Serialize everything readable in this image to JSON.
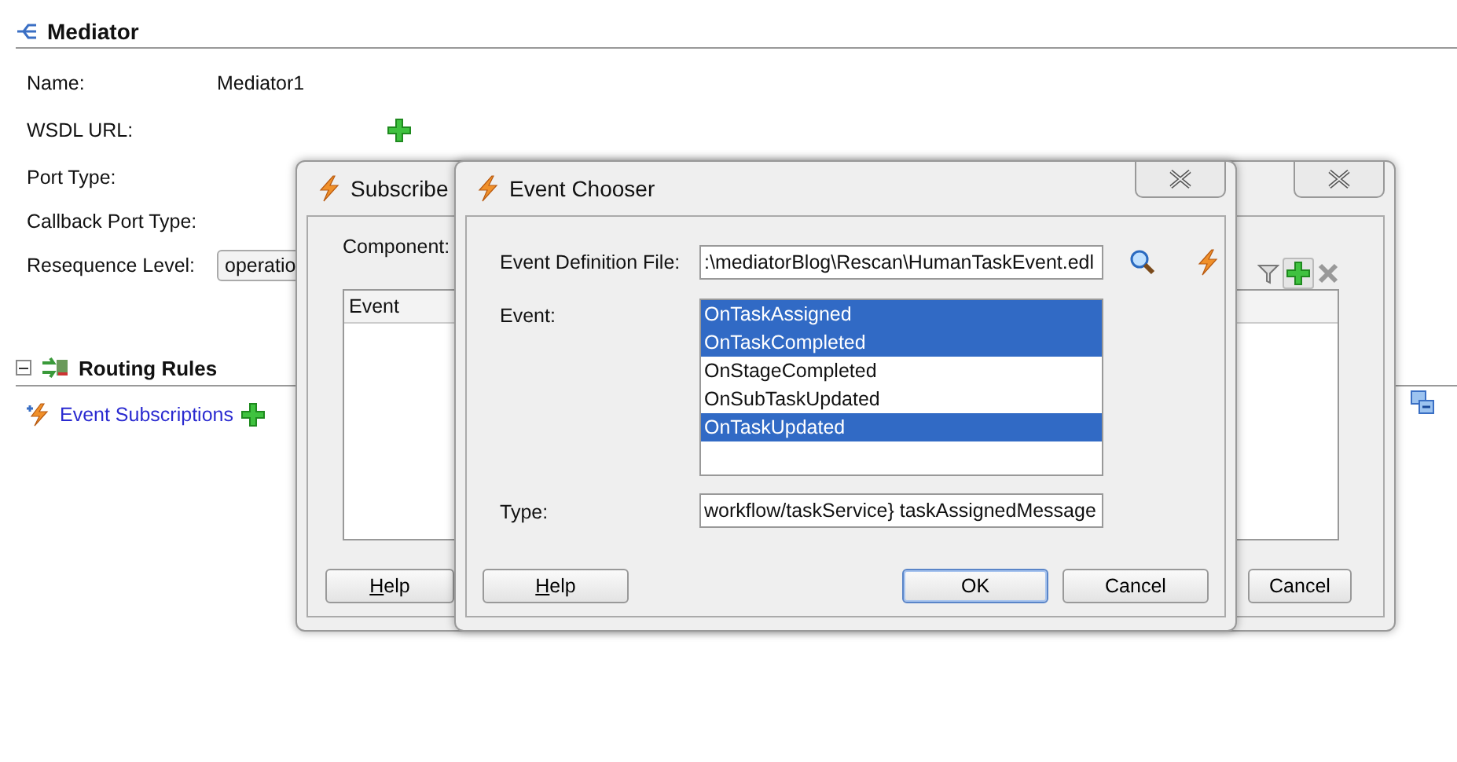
{
  "mediator": {
    "title": "Mediator",
    "fields": [
      {
        "label": "Name:",
        "kind": "text",
        "value": "Mediator1"
      },
      {
        "label": "WSDL URL:",
        "kind": "add"
      },
      {
        "label": "Port Type:",
        "kind": "plain"
      },
      {
        "label": "Callback Port Type:",
        "kind": "plain"
      },
      {
        "label": "Resequence Level:",
        "kind": "dropdown",
        "value": "operatio"
      }
    ],
    "routing": {
      "title": "Routing Rules",
      "expanded": true,
      "link": "Event Subscriptions"
    }
  },
  "subscribed_dialog": {
    "title": "Subscribe",
    "component_label": "Component:",
    "columns": [
      "Event"
    ],
    "buttons": [
      {
        "label": "Help",
        "mnemonic": true
      },
      {
        "label": "Cancel",
        "mnemonic": false
      }
    ]
  },
  "event_chooser": {
    "title": "Event Chooser",
    "file": {
      "label": "Event Definition File:",
      "value": ":\\mediatorBlog\\Rescan\\HumanTaskEvent.edl"
    },
    "event": {
      "label": "Event:",
      "options": [
        {
          "label": "OnTaskAssigned",
          "selected": true
        },
        {
          "label": "OnTaskCompleted",
          "selected": true
        },
        {
          "label": "OnStageCompleted",
          "selected": false
        },
        {
          "label": "OnSubTaskUpdated",
          "selected": false
        },
        {
          "label": "OnTaskUpdated",
          "selected": true
        }
      ]
    },
    "type": {
      "label": "Type:",
      "value": "workflow/taskService} taskAssignedMessage"
    },
    "buttons": [
      {
        "label": "Help",
        "mnemonic": true,
        "kind": "normal"
      },
      {
        "label": "OK",
        "mnemonic": false,
        "kind": "default"
      },
      {
        "label": "Cancel",
        "mnemonic": false,
        "kind": "normal"
      }
    ]
  }
}
